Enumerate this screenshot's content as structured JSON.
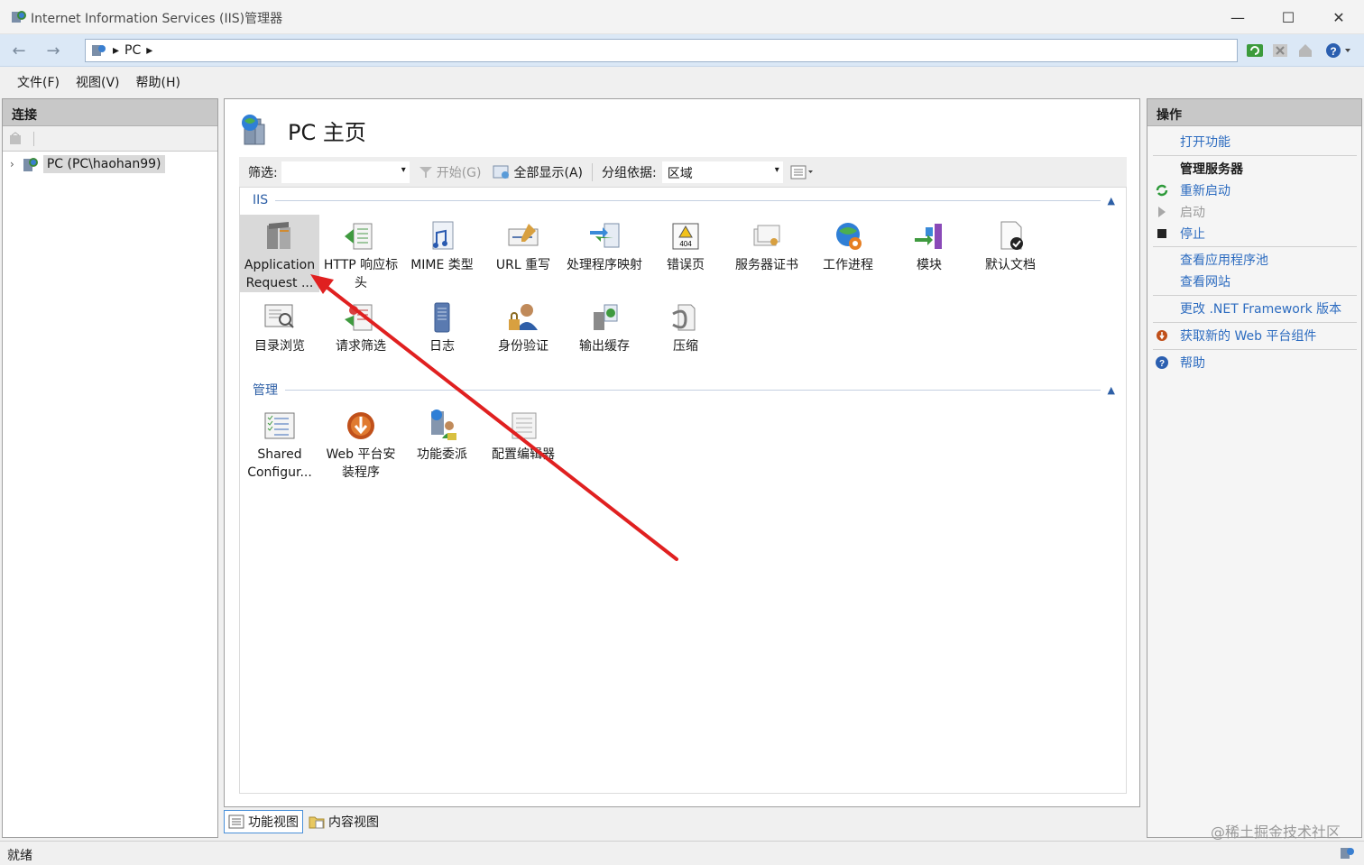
{
  "window": {
    "title": "Internet Information Services (IIS)管理器",
    "controls": {
      "minimize": "—",
      "maximize": "☐",
      "close": "✕"
    }
  },
  "address": {
    "back": "←",
    "forward": "→",
    "path": [
      "PC"
    ]
  },
  "menu": [
    "文件(F)",
    "视图(V)",
    "帮助(H)"
  ],
  "connections": {
    "title": "连接",
    "node": "PC (PC\\haohan99)"
  },
  "center": {
    "title": "PC 主页",
    "filter": {
      "label": "筛选:",
      "start": "开始(G)",
      "show_all": "全部显示(A)",
      "group_label": "分组依据:",
      "group_value": "区域"
    },
    "sections": [
      {
        "name": "IIS",
        "items": [
          {
            "label": "Application Request ...",
            "icon": "arr-server-icon"
          },
          {
            "label": "HTTP 响应标头",
            "icon": "http-headers-icon"
          },
          {
            "label": "MIME 类型",
            "icon": "mime-types-icon"
          },
          {
            "label": "URL 重写",
            "icon": "url-rewrite-icon"
          },
          {
            "label": "处理程序映射",
            "icon": "handler-mappings-icon"
          },
          {
            "label": "错误页",
            "icon": "error-pages-icon"
          },
          {
            "label": "服务器证书",
            "icon": "server-certificates-icon"
          },
          {
            "label": "工作进程",
            "icon": "worker-processes-icon"
          },
          {
            "label": "模块",
            "icon": "modules-icon"
          },
          {
            "label": "默认文档",
            "icon": "default-document-icon"
          },
          {
            "label": "目录浏览",
            "icon": "directory-browsing-icon"
          },
          {
            "label": "请求筛选",
            "icon": "request-filtering-icon"
          },
          {
            "label": "日志",
            "icon": "logging-icon"
          },
          {
            "label": "身份验证",
            "icon": "authentication-icon"
          },
          {
            "label": "输出缓存",
            "icon": "output-caching-icon"
          },
          {
            "label": "压缩",
            "icon": "compression-icon"
          }
        ]
      },
      {
        "name": "管理",
        "items": [
          {
            "label": "Shared Configur...",
            "icon": "shared-config-icon"
          },
          {
            "label": "Web 平台安装程序",
            "icon": "web-platform-installer-icon"
          },
          {
            "label": "功能委派",
            "icon": "feature-delegation-icon"
          },
          {
            "label": "配置编辑器",
            "icon": "configuration-editor-icon"
          }
        ]
      }
    ],
    "view_tabs": [
      "功能视图",
      "内容视图"
    ]
  },
  "actions": {
    "title": "操作",
    "open_feature": "打开功能",
    "group_title": "管理服务器",
    "restart": "重新启动",
    "start": "启动",
    "stop": "停止",
    "view_app_pools": "查看应用程序池",
    "view_sites": "查看网站",
    "change_net": "更改 .NET Framework 版本",
    "get_components": "获取新的 Web 平台组件",
    "help": "帮助"
  },
  "status": {
    "text": "就绪",
    "watermark": "@稀土掘金技术社区"
  },
  "colors": {
    "link": "#2d6cc0",
    "section": "#2d5fa6",
    "annotation_arrow": "#e02020"
  }
}
